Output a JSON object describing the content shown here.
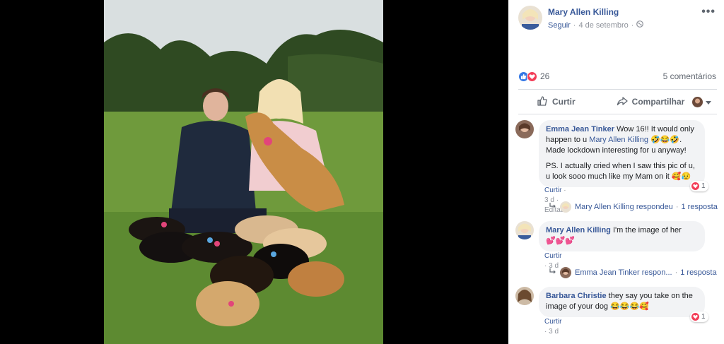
{
  "post": {
    "author": "Mary Allen Killing",
    "follow": "Seguir",
    "date": "4 de setembro",
    "more": "•••"
  },
  "stats": {
    "reactions": "26",
    "comments": "5 comentários"
  },
  "actions": {
    "like": "Curtir",
    "share": "Compartilhar"
  },
  "comments": [
    {
      "name": "Emma Jean Tinker",
      "text1": "Wow 16!! It would only happen to u",
      "mention": "Mary Allen Killing",
      "emoji1": "🤣😂🤣",
      "text2": "Made lockdown interesting for u anyway!",
      "text3": "PS. I actually cried when I saw this pic of u, u look sooo much like my Mam on it",
      "emoji2": "🥰😥",
      "like": "Curtir",
      "time": "3 d",
      "edited": "Editado",
      "reactions": "1",
      "reply_author": "Mary Allen Killing respondeu",
      "reply_count": "1 resposta"
    },
    {
      "name": "Mary Allen Killing",
      "text": "I'm the image of her",
      "emoji": "💕💕💕",
      "like": "Curtir",
      "time": "3 d",
      "reply_author": "Emma Jean Tinker respon...",
      "reply_count": "1 resposta"
    },
    {
      "name": "Barbara Christie",
      "text": "they say you take on the image of your dog",
      "emoji": "😂😂😂🥰",
      "like": "Curtir",
      "time": "3 d",
      "reactions": "1"
    }
  ]
}
